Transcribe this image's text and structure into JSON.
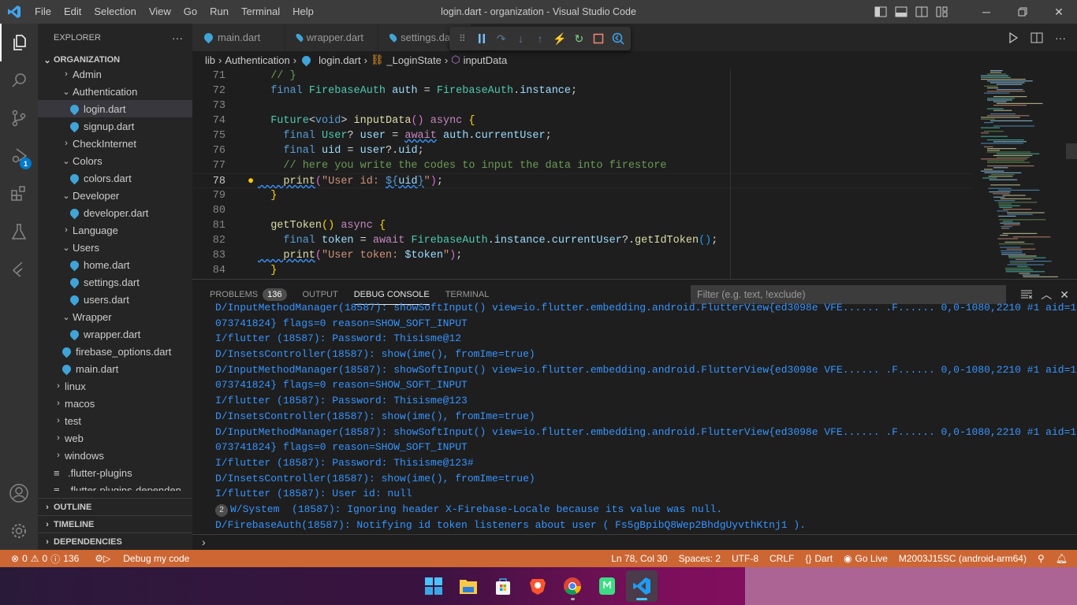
{
  "titlebar": {
    "menu": [
      "File",
      "Edit",
      "Selection",
      "View",
      "Go",
      "Run",
      "Terminal",
      "Help"
    ],
    "title": "login.dart - organization - Visual Studio Code"
  },
  "activity": {
    "debug_badge": "1"
  },
  "sidebar": {
    "header": "EXPLORER",
    "more": "···",
    "root": "ORGANIZATION",
    "items": [
      {
        "label": "Admin",
        "type": "folder",
        "open": false,
        "depth": 1
      },
      {
        "label": "Authentication",
        "type": "folder",
        "open": true,
        "depth": 1
      },
      {
        "label": "login.dart",
        "type": "dart",
        "depth": 2,
        "selected": true
      },
      {
        "label": "signup.dart",
        "type": "dart",
        "depth": 2
      },
      {
        "label": "CheckInternet",
        "type": "folder",
        "open": false,
        "depth": 1
      },
      {
        "label": "Colors",
        "type": "folder",
        "open": true,
        "depth": 1
      },
      {
        "label": "colors.dart",
        "type": "dart",
        "depth": 2
      },
      {
        "label": "Developer",
        "type": "folder",
        "open": true,
        "depth": 1
      },
      {
        "label": "developer.dart",
        "type": "dart",
        "depth": 2
      },
      {
        "label": "Language",
        "type": "folder",
        "open": false,
        "depth": 1
      },
      {
        "label": "Users",
        "type": "folder",
        "open": true,
        "depth": 1
      },
      {
        "label": "home.dart",
        "type": "dart",
        "depth": 2
      },
      {
        "label": "settings.dart",
        "type": "dart",
        "depth": 2
      },
      {
        "label": "users.dart",
        "type": "dart",
        "depth": 2
      },
      {
        "label": "Wrapper",
        "type": "folder",
        "open": true,
        "depth": 1
      },
      {
        "label": "wrapper.dart",
        "type": "dart",
        "depth": 2
      },
      {
        "label": "firebase_options.dart",
        "type": "dart",
        "depth": 1
      },
      {
        "label": "main.dart",
        "type": "dart",
        "depth": 1
      },
      {
        "label": "linux",
        "type": "folder",
        "open": false,
        "depth": 0
      },
      {
        "label": "macos",
        "type": "folder",
        "open": false,
        "depth": 0
      },
      {
        "label": "test",
        "type": "folder",
        "open": false,
        "depth": 0
      },
      {
        "label": "web",
        "type": "folder",
        "open": false,
        "depth": 0
      },
      {
        "label": "windows",
        "type": "folder",
        "open": false,
        "depth": 0
      },
      {
        "label": ".flutter-plugins",
        "type": "file",
        "depth": 0
      },
      {
        "label": ".flutter-plugins-dependen",
        "type": "file",
        "depth": 0
      }
    ],
    "sections": [
      "OUTLINE",
      "TIMELINE",
      "DEPENDENCIES"
    ]
  },
  "editor": {
    "tabs": [
      "main.dart",
      "wrapper.dart",
      "settings.dart"
    ],
    "breadcrumb": [
      "lib",
      "Authentication",
      "login.dart",
      "_LoginState",
      "inputData"
    ],
    "current_line": 78,
    "lines": [
      {
        "n": 71,
        "tokens": [
          [
            "cm",
            "  // }"
          ]
        ]
      },
      {
        "n": 72,
        "tokens": [
          [
            "kw",
            "  final "
          ],
          [
            "ty",
            "FirebaseAuth "
          ],
          [
            "vr",
            "auth"
          ],
          [
            "ctext",
            " = "
          ],
          [
            "ty",
            "FirebaseAuth"
          ],
          [
            "ctext",
            "."
          ],
          [
            "vr",
            "instance"
          ],
          [
            "ctext",
            ";"
          ]
        ]
      },
      {
        "n": 73,
        "tokens": []
      },
      {
        "n": 74,
        "tokens": [
          [
            "ty",
            "  Future"
          ],
          [
            "ctext",
            "<"
          ],
          [
            "kw",
            "void"
          ],
          [
            "ctext",
            "> "
          ],
          [
            "fn",
            "inputData"
          ],
          [
            "br2",
            "()"
          ],
          [
            "ctext",
            " "
          ],
          [
            "ct",
            "async"
          ],
          [
            "ctext",
            " "
          ],
          [
            "br",
            "{"
          ]
        ]
      },
      {
        "n": 75,
        "tokens": [
          [
            "kw",
            "    final "
          ],
          [
            "ty",
            "User"
          ],
          [
            "ctext",
            "? "
          ],
          [
            "vr",
            "user"
          ],
          [
            "ctext",
            " = "
          ],
          [
            "ct sq",
            "await"
          ],
          [
            "ctext",
            " "
          ],
          [
            "vr",
            "auth"
          ],
          [
            "ctext",
            "."
          ],
          [
            "vr",
            "currentUser"
          ],
          [
            "ctext",
            ";"
          ]
        ]
      },
      {
        "n": 76,
        "tokens": [
          [
            "kw",
            "    final "
          ],
          [
            "vr",
            "uid"
          ],
          [
            "ctext",
            " = "
          ],
          [
            "vr",
            "user"
          ],
          [
            "ctext",
            "?."
          ],
          [
            "vr",
            "uid"
          ],
          [
            "ctext",
            ";"
          ]
        ]
      },
      {
        "n": 77,
        "tokens": [
          [
            "cm",
            "    // here you write the codes to input the data into firestore"
          ]
        ]
      },
      {
        "n": 78,
        "tokens": [
          [
            "fn sq",
            "    print"
          ],
          [
            "br2",
            "("
          ],
          [
            "st",
            "\"User id: "
          ],
          [
            "kw sq",
            "${"
          ],
          [
            "vr sq",
            "uid"
          ],
          [
            "kw sq",
            "}"
          ],
          [
            "st",
            "\""
          ],
          [
            "br2",
            ")"
          ],
          [
            "ctext",
            ";"
          ]
        ]
      },
      {
        "n": 79,
        "tokens": [
          [
            "br",
            "  }"
          ]
        ]
      },
      {
        "n": 80,
        "tokens": []
      },
      {
        "n": 81,
        "tokens": [
          [
            "fn",
            "  getToken"
          ],
          [
            "br",
            "()"
          ],
          [
            "ctext",
            " "
          ],
          [
            "ct",
            "async"
          ],
          [
            "ctext",
            " "
          ],
          [
            "br",
            "{"
          ]
        ]
      },
      {
        "n": 82,
        "tokens": [
          [
            "kw",
            "    final "
          ],
          [
            "vr",
            "token"
          ],
          [
            "ctext",
            " = "
          ],
          [
            "ct",
            "await"
          ],
          [
            "ctext",
            " "
          ],
          [
            "ty",
            "FirebaseAuth"
          ],
          [
            "ctext",
            "."
          ],
          [
            "vr",
            "instance"
          ],
          [
            "ctext",
            "."
          ],
          [
            "vr",
            "currentUser"
          ],
          [
            "ctext",
            "?."
          ],
          [
            "fn",
            "getIdToken"
          ],
          [
            "br3",
            "()"
          ],
          [
            "ctext",
            ";"
          ]
        ]
      },
      {
        "n": 83,
        "tokens": [
          [
            "fn sq",
            "    print"
          ],
          [
            "br2",
            "("
          ],
          [
            "st",
            "\"User token: "
          ],
          [
            "vr",
            "$token"
          ],
          [
            "st",
            "\""
          ],
          [
            "br2",
            ")"
          ],
          [
            "ctext",
            ";"
          ]
        ]
      },
      {
        "n": 84,
        "tokens": [
          [
            "br",
            "  }"
          ]
        ]
      }
    ]
  },
  "panel": {
    "tabs": [
      {
        "label": "PROBLEMS",
        "count": "136"
      },
      {
        "label": "OUTPUT"
      },
      {
        "label": "DEBUG CONSOLE",
        "active": true
      },
      {
        "label": "TERMINAL"
      }
    ],
    "filter_placeholder": "Filter (e.g. text, !exclude)",
    "console": [
      {
        "text": "D/InputMethodManager(18587): showSoftInput() view=io.flutter.embedding.android.FlutterView{ed3098e VFE...... .F...... 0,0-1080,2210 #1 aid=1"
      },
      {
        "text": "073741824} flags=0 reason=SHOW_SOFT_INPUT"
      },
      {
        "text": "I/flutter (18587): Password: Thisisme@12"
      },
      {
        "text": "D/InsetsController(18587): show(ime(), fromIme=true)"
      },
      {
        "text": "D/InputMethodManager(18587): showSoftInput() view=io.flutter.embedding.android.FlutterView{ed3098e VFE...... .F...... 0,0-1080,2210 #1 aid=1"
      },
      {
        "text": "073741824} flags=0 reason=SHOW_SOFT_INPUT"
      },
      {
        "text": "I/flutter (18587): Password: Thisisme@123"
      },
      {
        "text": "D/InsetsController(18587): show(ime(), fromIme=true)"
      },
      {
        "text": "D/InputMethodManager(18587): showSoftInput() view=io.flutter.embedding.android.FlutterView{ed3098e VFE...... .F...... 0,0-1080,2210 #1 aid=1"
      },
      {
        "text": "073741824} flags=0 reason=SHOW_SOFT_INPUT"
      },
      {
        "text": "I/flutter (18587): Password: Thisisme@123#"
      },
      {
        "text": "D/InsetsController(18587): show(ime(), fromIme=true)"
      },
      {
        "text": "I/flutter (18587): User id: null"
      },
      {
        "text": "W/System  (18587): Ignoring header X-Firebase-Locale because its value was null.",
        "repeat": "2"
      },
      {
        "text": "D/FirebaseAuth(18587): Notifying id token listeners about user ( Fs5gBpibQ8Wep2BhdgUyvthKtnj1 )."
      }
    ],
    "prompt": "›"
  },
  "statusbar": {
    "errors": "0",
    "warnings": "0",
    "infos": "136",
    "debug_label": "Debug my code",
    "position": "Ln 78, Col 30",
    "spaces": "Spaces: 2",
    "encoding": "UTF-8",
    "eol": "CRLF",
    "language": "Dart",
    "golive": "Go Live",
    "device": "M2003J15SC (android-arm64)"
  },
  "taskbar": {
    "apps": [
      "start",
      "file-explorer",
      "microsoft-store",
      "brave",
      "chrome",
      "android-app",
      "vscode"
    ]
  }
}
